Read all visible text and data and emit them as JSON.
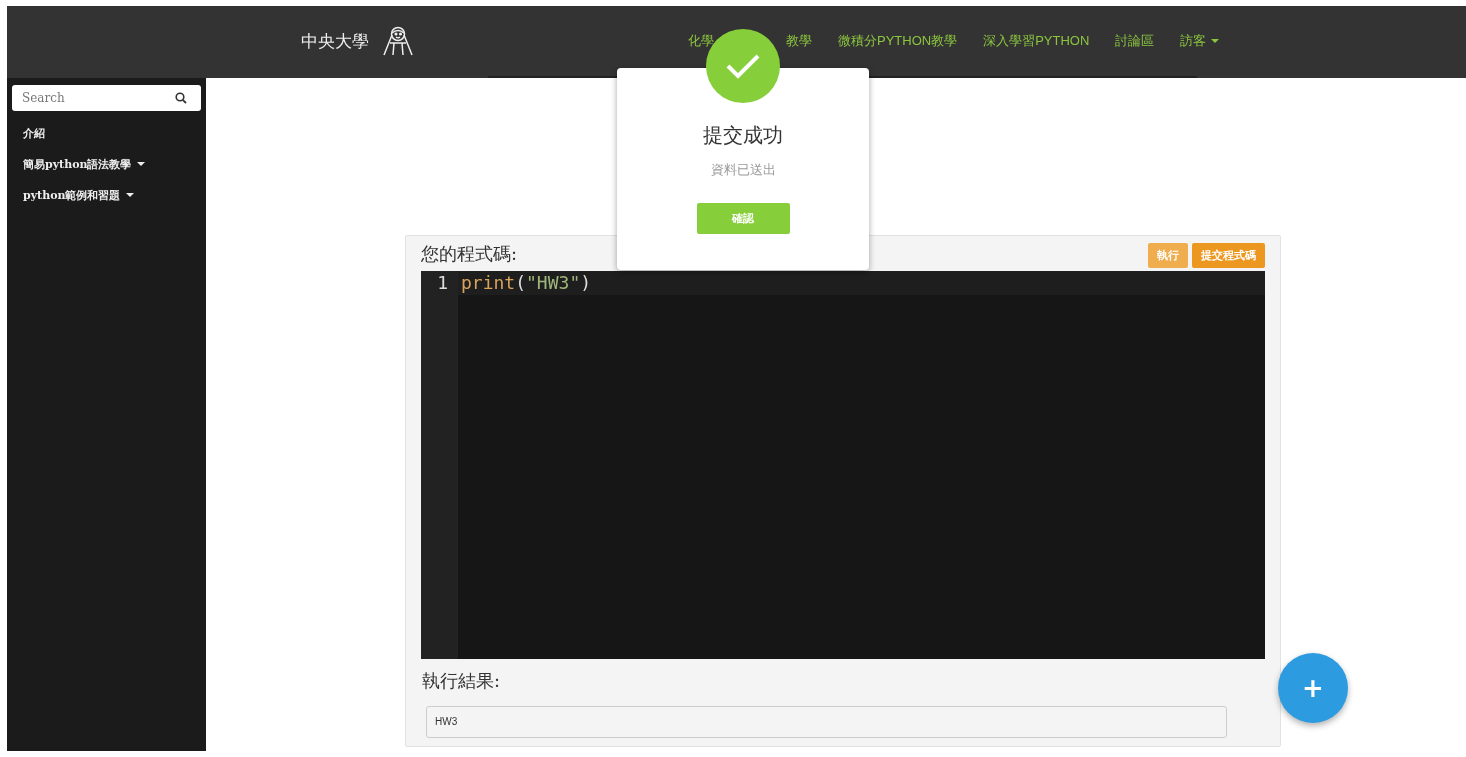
{
  "header": {
    "brand": "中央大學",
    "nav": [
      {
        "kind": "partial",
        "label_start": "化學",
        "label_end": "教學"
      },
      {
        "kind": "link",
        "label": "微積分PYTHON教學"
      },
      {
        "kind": "link",
        "label": "深入學習PYTHON"
      },
      {
        "kind": "link",
        "label": "討論區"
      },
      {
        "kind": "dropdown",
        "label": "訪客"
      }
    ]
  },
  "sidebar": {
    "search": {
      "placeholder": "Search"
    },
    "items": [
      {
        "label": "介紹",
        "dropdown": false
      },
      {
        "label": "簡易python語法教學",
        "dropdown": true
      },
      {
        "label": "python範例和習題",
        "dropdown": true
      }
    ]
  },
  "editor_panel": {
    "title": "您的程式碼:",
    "buttons": [
      "執行",
      "提交程式碼"
    ],
    "code_lines": [
      {
        "number": "1",
        "func": "print",
        "open": "(",
        "string": "\"HW3\"",
        "close": ")"
      }
    ],
    "output_title": "執行結果:",
    "output": "HW3"
  },
  "dialog": {
    "title": "提交成功",
    "message": "資料已送出",
    "button": "確認"
  },
  "fab": {
    "label": "+"
  }
}
